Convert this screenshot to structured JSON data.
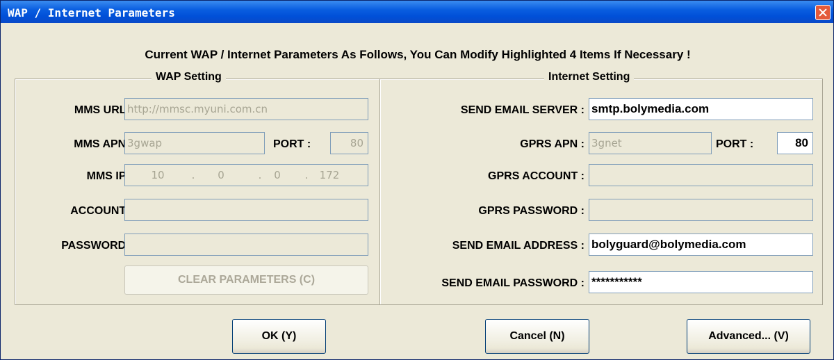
{
  "window": {
    "title": "WAP / Internet Parameters"
  },
  "headline": "Current WAP / Internet Parameters As Follows, You Can Modify Highlighted 4 Items If Necessary !",
  "wap": {
    "group_title": "WAP Setting",
    "mms_url_label": "MMS URL :",
    "mms_url_value": "http://mmsc.myuni.com.cn",
    "mms_apn_label": "MMS APN :",
    "mms_apn_value": "3gwap",
    "port_label": "PORT :",
    "port_value": "80",
    "mms_ip_label": "MMS IP :",
    "mms_ip": [
      "10",
      "0",
      "0",
      "172"
    ],
    "ip_dot": ".",
    "account_label": "ACCOUNT :",
    "account_value": "",
    "password_label": "PASSWORD :",
    "password_value": "",
    "clear_button": "CLEAR PARAMETERS (C)"
  },
  "internet": {
    "group_title": "Internet Setting",
    "send_email_server_label": "SEND EMAIL SERVER :",
    "send_email_server_value": "smtp.bolymedia.com",
    "gprs_apn_label": "GPRS APN :",
    "gprs_apn_value": "3gnet",
    "port_label": "PORT :",
    "port_value": "80",
    "gprs_account_label": "GPRS ACCOUNT :",
    "gprs_account_value": "",
    "gprs_password_label": "GPRS PASSWORD :",
    "gprs_password_value": "",
    "send_email_address_label": "SEND EMAIL ADDRESS :",
    "send_email_address_value": "bolyguard@bolymedia.com",
    "send_email_password_label": "SEND EMAIL PASSWORD :",
    "send_email_password_value": "***********"
  },
  "buttons": {
    "ok": "OK (Y)",
    "cancel": "Cancel (N)",
    "advanced": "Advanced... (V)"
  },
  "colors": {
    "titlebar": "#0a5ee0",
    "dialog_bg": "#ece9d8",
    "close": "#e45a3a"
  }
}
